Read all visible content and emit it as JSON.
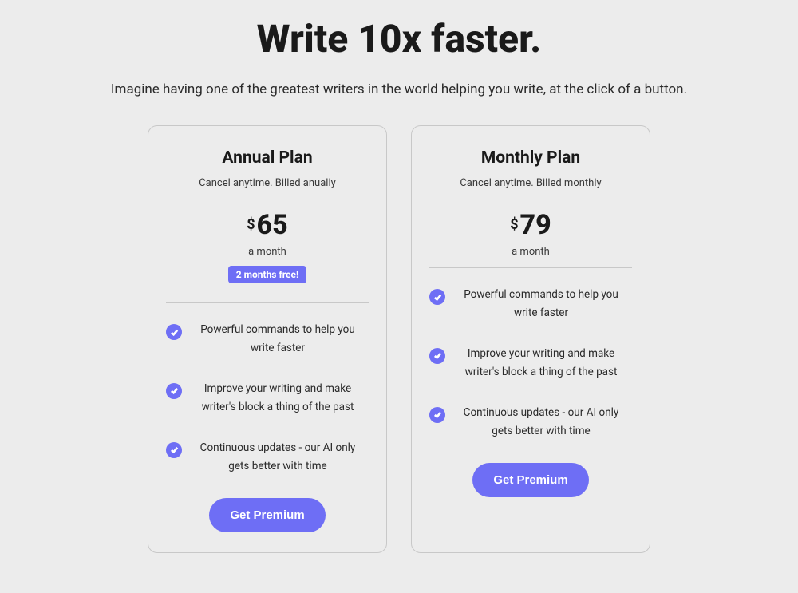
{
  "heading": "Write 10x faster.",
  "subheading": "Imagine having one of the greatest writers in the world helping you write, at the click of a button.",
  "colors": {
    "accent": "#6e6ef5"
  },
  "plans": [
    {
      "title": "Annual Plan",
      "note": "Cancel anytime. Billed anually",
      "currency": "$",
      "price": "65",
      "per": "a month",
      "badge": "2 months free!",
      "features": [
        "Powerful commands to help you write faster",
        "Improve your writing and make writer's block a thing of the past",
        "Continuous updates - our AI only gets better with time"
      ],
      "cta": "Get Premium"
    },
    {
      "title": "Monthly Plan",
      "note": "Cancel anytime. Billed monthly",
      "currency": "$",
      "price": "79",
      "per": "a month",
      "badge": null,
      "features": [
        "Powerful commands to help you write faster",
        "Improve your writing and make writer's block a thing of the past",
        "Continuous updates - our AI only gets better with time"
      ],
      "cta": "Get Premium"
    }
  ]
}
